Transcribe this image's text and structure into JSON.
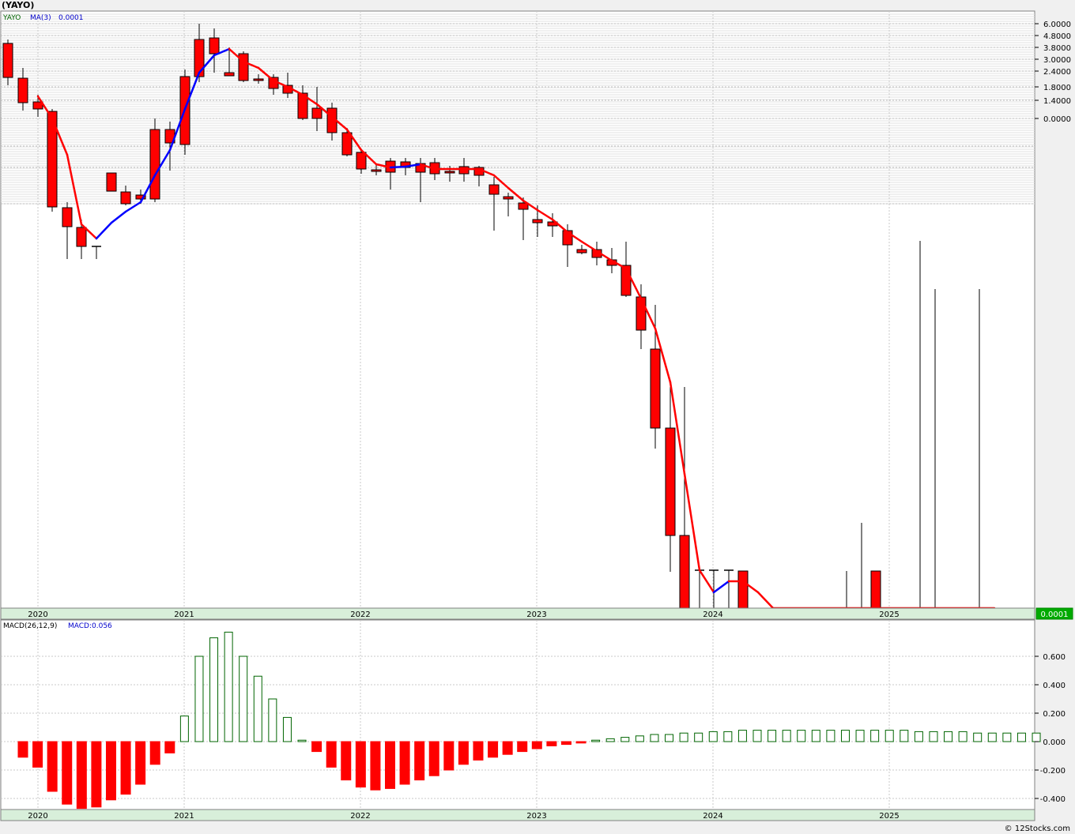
{
  "title": "(YAYO)",
  "copyright": "© 12Stocks.com",
  "chart_data": [
    {
      "type": "candlestick",
      "symbol": "YAYO",
      "legend": {
        "symbol_label": "YAYO",
        "ma_label": "MA(3)",
        "ma_value": "0.0001"
      },
      "price_tag": "0.0001",
      "y_tick_labels": [
        "6.0000",
        "4.8000",
        "3.8000",
        "3.0000",
        "2.4000",
        "1.8000",
        "1.4000",
        "0.0000"
      ],
      "year_labels": [
        "2020",
        "2021",
        "2022",
        "2023",
        "2024",
        "2025"
      ],
      "grid": true,
      "colors": {
        "up": "#ffffff",
        "down": "#ff0000",
        "ma_down": "#ff0000",
        "ma_up": "#0000ff",
        "panel": "#ffffff",
        "axis_band": "#d8efda",
        "price_tag": "#00aa00"
      }
    },
    {
      "type": "bar",
      "indicator": "MACD histogram",
      "legend": {
        "label": "MACD(26,12,9)",
        "value_label": "MACD:0.056"
      },
      "y_tick_labels": [
        "0.600",
        "0.400",
        "0.200",
        "0.000",
        "-0.200",
        "-0.400"
      ],
      "y_ticks": [
        0.6,
        0.4,
        0.2,
        0.0,
        -0.2,
        -0.4
      ],
      "year_labels": [
        "2020",
        "2021",
        "2022",
        "2023",
        "2024",
        "2025"
      ],
      "values": [
        -0.11,
        -0.18,
        -0.35,
        -0.44,
        -0.47,
        -0.46,
        -0.41,
        -0.37,
        -0.3,
        -0.16,
        -0.08,
        0.18,
        0.6,
        0.73,
        0.77,
        0.6,
        0.46,
        0.3,
        0.17,
        0.01,
        -0.07,
        -0.18,
        -0.27,
        -0.32,
        -0.34,
        -0.33,
        -0.3,
        -0.27,
        -0.24,
        -0.2,
        -0.16,
        -0.13,
        -0.11,
        -0.09,
        -0.07,
        -0.05,
        -0.03,
        -0.02,
        -0.01,
        0.01,
        0.02,
        0.03,
        0.04,
        0.05,
        0.05,
        0.06,
        0.06,
        0.07,
        0.07,
        0.08,
        0.08,
        0.08,
        0.08,
        0.08,
        0.08,
        0.08,
        0.08,
        0.08,
        0.08,
        0.08,
        0.08,
        0.07,
        0.07,
        0.07,
        0.07,
        0.06,
        0.06,
        0.06,
        0.06,
        0.06
      ],
      "colors": {
        "positive": "#006400",
        "negative": "#ff0000"
      }
    }
  ]
}
